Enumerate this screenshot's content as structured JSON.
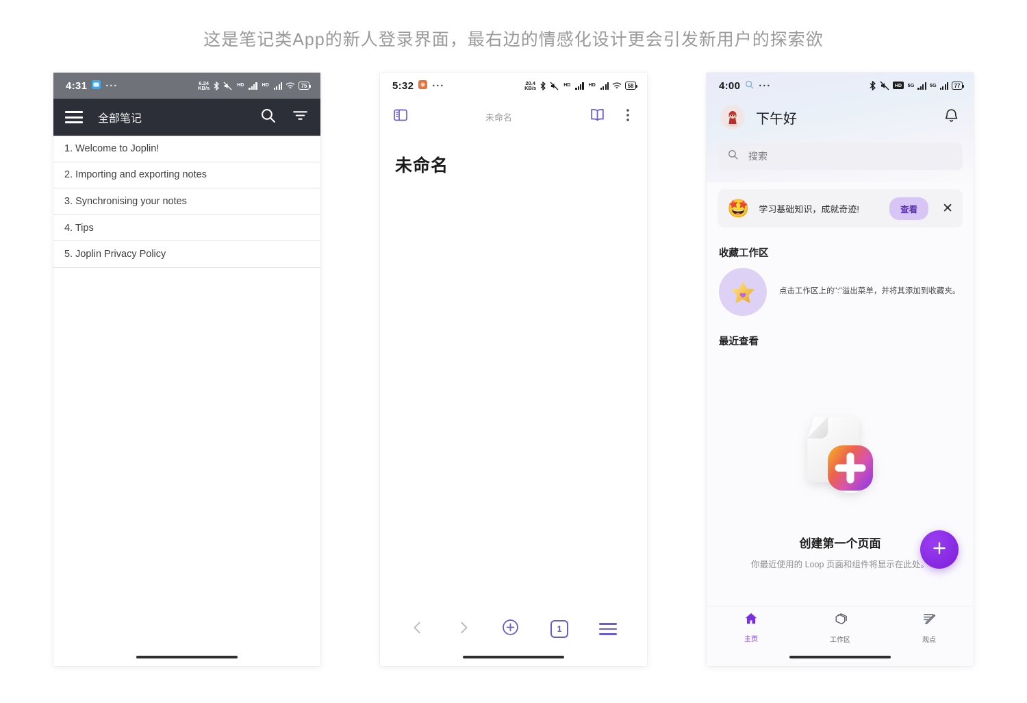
{
  "caption": "这是笔记类App的新人登录界面，最右边的情感化设计更会引发新用户的探索欲",
  "colors": {
    "joplin_header": "#2c2f38",
    "accent_purple": "#6b5bd2",
    "fab_purple": "#7c1fd9",
    "promo_button_bg": "#d7c6f5"
  },
  "phone1": {
    "status": {
      "time": "4:31",
      "net_value": "6.24",
      "net_unit": "KB/s",
      "battery": "75",
      "icons": [
        "bluetooth-icon",
        "mute-icon",
        "hd-signal-icon",
        "hd-signal-icon",
        "wifi-icon",
        "battery-icon"
      ],
      "dots": "···"
    },
    "header": {
      "menu_icon": "hamburger-icon",
      "title": "全部笔记",
      "search_icon": "search-icon",
      "filter_icon": "filter-icon"
    },
    "notes": [
      "1. Welcome to Joplin!",
      "2. Importing and exporting notes",
      "3. Synchronising your notes",
      "4. Tips",
      "5. Joplin Privacy Policy"
    ]
  },
  "phone2": {
    "status": {
      "time": "5:32",
      "net_value": "20.4",
      "net_unit": "KB/s",
      "battery": "58",
      "dots": "···"
    },
    "header": {
      "sidebar_icon": "sidebar-toggle-icon",
      "breadcrumb": "未命名",
      "book_icon": "book-icon",
      "overflow_icon": "overflow-menu-icon"
    },
    "document": {
      "title": "未命名"
    },
    "toolbar": {
      "back_icon": "chevron-left-icon",
      "forward_icon": "chevron-right-icon",
      "add_icon": "plus-circle-icon",
      "tab_count": "1",
      "menu_icon": "hamburger-icon"
    }
  },
  "phone3": {
    "status": {
      "time": "4:00",
      "battery": "77",
      "dots": "···",
      "icons": [
        "bluetooth-icon",
        "mute-icon",
        "hd-badge-icon",
        "5g-signal-icon",
        "5g-signal-icon",
        "battery-icon"
      ]
    },
    "header": {
      "avatar": "avatar-character",
      "greeting": "下午好",
      "bell_icon": "notification-bell-icon"
    },
    "search": {
      "icon": "search-icon",
      "placeholder": "搜索"
    },
    "promo": {
      "emoji": "star-struck-emoji",
      "text": "学习基础知识，成就奇迹!",
      "button": "查看",
      "close_icon": "close-icon"
    },
    "favorites": {
      "title": "收藏工作区",
      "icon": "star-heart-icon",
      "hint": "点击工作区上的\":\"溢出菜单，并将其添加到收藏夹。"
    },
    "recent": {
      "title": "最近查看",
      "illustration": "page-with-plus-illustration",
      "empty_title": "创建第一个页面",
      "empty_sub": "你最近使用的 Loop 页面和组件将显示在此处。"
    },
    "fab": {
      "icon": "plus-icon"
    },
    "nav": [
      {
        "label": "主页",
        "icon": "home-icon",
        "active": true
      },
      {
        "label": "工作区",
        "icon": "workspace-icon",
        "active": false
      },
      {
        "label": "观点",
        "icon": "ideas-pen-icon",
        "active": false
      }
    ]
  }
}
